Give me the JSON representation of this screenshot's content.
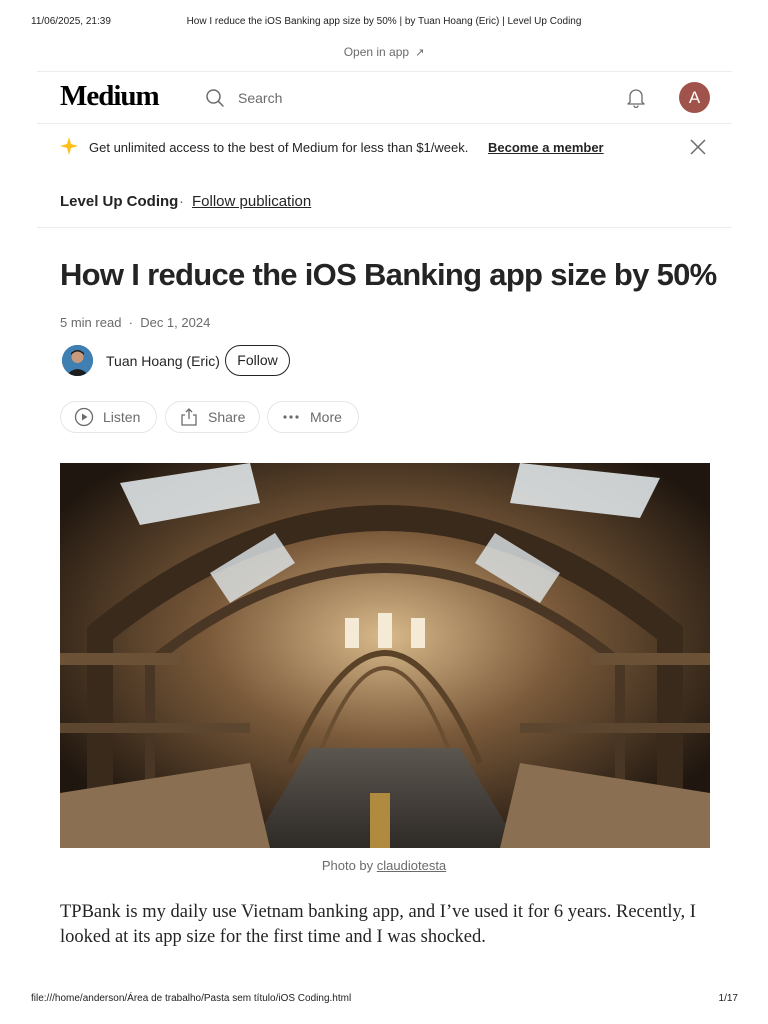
{
  "print": {
    "datetime": "11/06/2025, 21:39",
    "doc_title": "How I reduce the iOS Banking app size by 50% | by Tuan Hoang (Eric) | Level Up Coding",
    "url": "file:///home/anderson/Área de trabalho/Pasta sem título/iOS Coding.html",
    "page": "1/17"
  },
  "open_app": {
    "label": "Open in app",
    "arrow": "↗"
  },
  "header": {
    "logo": "Medium",
    "search_placeholder": "Search",
    "avatar_letter": "A"
  },
  "promo": {
    "text": "Get unlimited access to the best of Medium for less than $1/week.",
    "link": "Become a member"
  },
  "publication": {
    "name": "Level Up Coding",
    "separator": "·",
    "follow_label": "Follow publication"
  },
  "article": {
    "title": "How I reduce the iOS Banking app size by 50%",
    "meta": "5 min read  ·  Dec 1, 2024",
    "author": "Tuan Hoang (Eric)",
    "follow_label": "Follow",
    "actions": {
      "listen": "Listen",
      "share": "Share",
      "more": "More"
    },
    "caption_prefix": "Photo by",
    "caption_author": "claudiotesta",
    "body": "TPBank is my daily use Vietnam banking app, and I’ve used it for 6 years. Recently, I looked at its app size for the first time and I was shocked."
  },
  "colors": {
    "text": "#242424",
    "muted": "#6b6b6b",
    "avatar": "#a0534a",
    "star": "#ffc017"
  }
}
